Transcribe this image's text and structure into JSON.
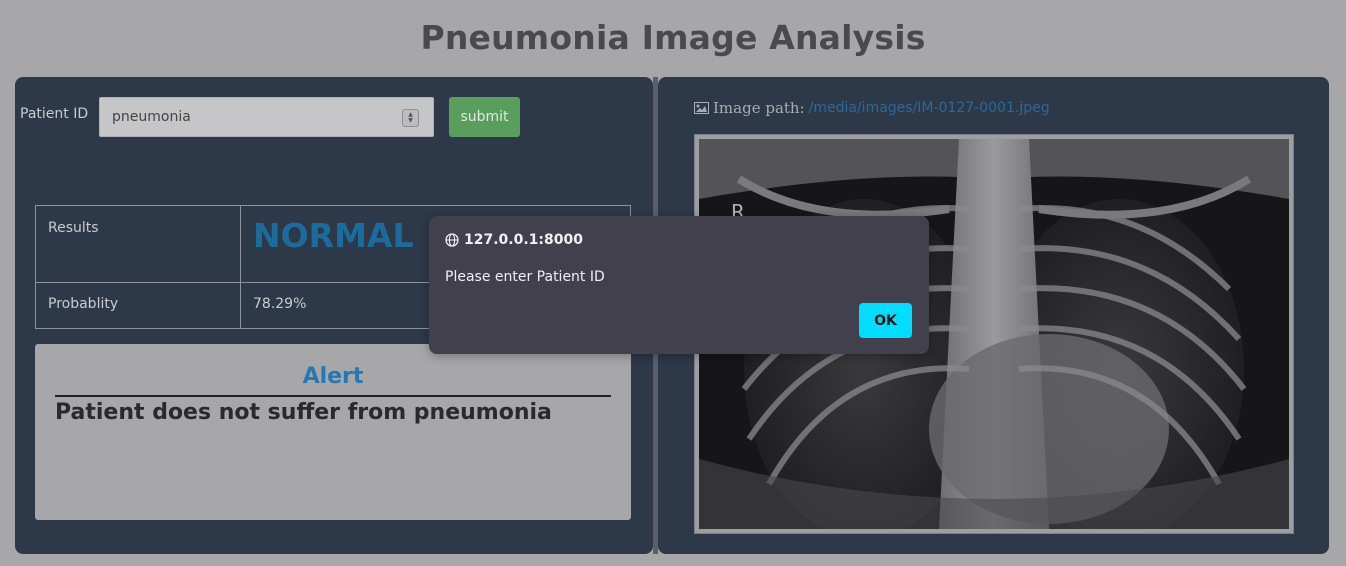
{
  "page": {
    "title": "Pneumonia Image Analysis"
  },
  "form": {
    "patient_id_label": "Patient ID",
    "patient_id_value": "pneumonia",
    "submit_label": "submit"
  },
  "results": {
    "result_label": "Results",
    "result_value": "NORMAL",
    "probability_label": "Probablity",
    "probability_value": "78.29%"
  },
  "alert": {
    "title": "Alert",
    "message": "Patient does not suffer from pneumonia"
  },
  "image": {
    "path_label": "Image path:",
    "path_value": "/media/images/IM-0127-0001.jpeg",
    "xray_marker": "R"
  },
  "dialog": {
    "origin": "127.0.0.1:8000",
    "message": "Please enter Patient ID",
    "ok_label": "OK"
  },
  "icons": [
    "image-icon",
    "globe-icon",
    "stepper-icon"
  ],
  "colors": {
    "background": "#a7a7a9",
    "panel": "#2d3848",
    "submit": "#5a9e5e",
    "result_value": "#1d6b9c",
    "alert_title": "#2578b3",
    "ok_button": "#00ddff"
  }
}
